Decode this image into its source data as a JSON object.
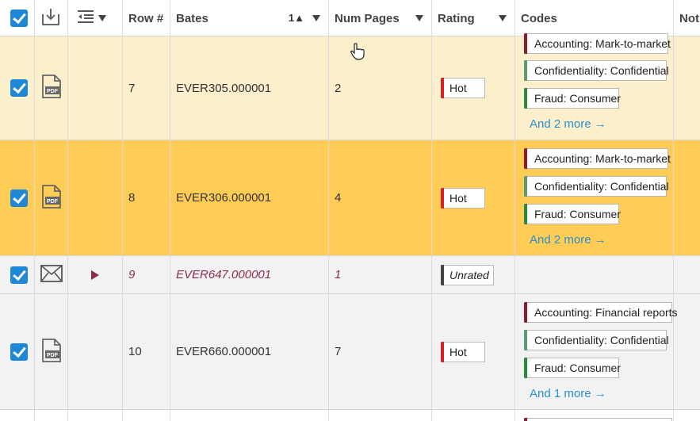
{
  "colors": {
    "row_light": "#fbefcc",
    "row_selected": "#ffcc55",
    "row_plain": "#f2f2f2",
    "accent": "#1e88d6",
    "link": "#2a8fd1",
    "hot": "#d62222",
    "unrated": "#444444",
    "accounting": "#8b1b2e",
    "confidentiality": "#5a9a72",
    "fraud": "#2a8a3a"
  },
  "header": {
    "columns": [
      {
        "id": "select",
        "label": ""
      },
      {
        "id": "download",
        "label": ""
      },
      {
        "id": "indent",
        "label": ""
      },
      {
        "id": "row",
        "label": "Row #"
      },
      {
        "id": "bates",
        "label": "Bates"
      },
      {
        "id": "pages",
        "label": "Num Pages"
      },
      {
        "id": "rating",
        "label": "Rating"
      },
      {
        "id": "codes",
        "label": "Codes"
      },
      {
        "id": "notes",
        "label": "Not"
      }
    ],
    "bates_sort": "1▲"
  },
  "rows": [
    {
      "row": "7",
      "bates": "EVER305.000001",
      "pages": "2",
      "rating": "Hot",
      "codes": [
        "Accounting: Mark-to-market",
        "Confidentiality: Confidential",
        "Fraud: Consumer"
      ],
      "more": "And 2 more →"
    },
    {
      "row": "8",
      "bates": "EVER306.000001",
      "pages": "4",
      "rating": "Hot",
      "codes": [
        "Accounting: Mark-to-market",
        "Confidentiality: Confidential",
        "Fraud: Consumer"
      ],
      "more": "And 2 more →"
    },
    {
      "row": "9",
      "bates": "EVER647.000001",
      "pages": "1",
      "rating": "Unrated"
    },
    {
      "row": "10",
      "bates": "EVER660.000001",
      "pages": "7",
      "rating": "Hot",
      "codes": [
        "Accounting: Financial reports",
        "Confidentiality: Confidential",
        "Fraud: Consumer"
      ],
      "more": "And 1 more →"
    }
  ]
}
